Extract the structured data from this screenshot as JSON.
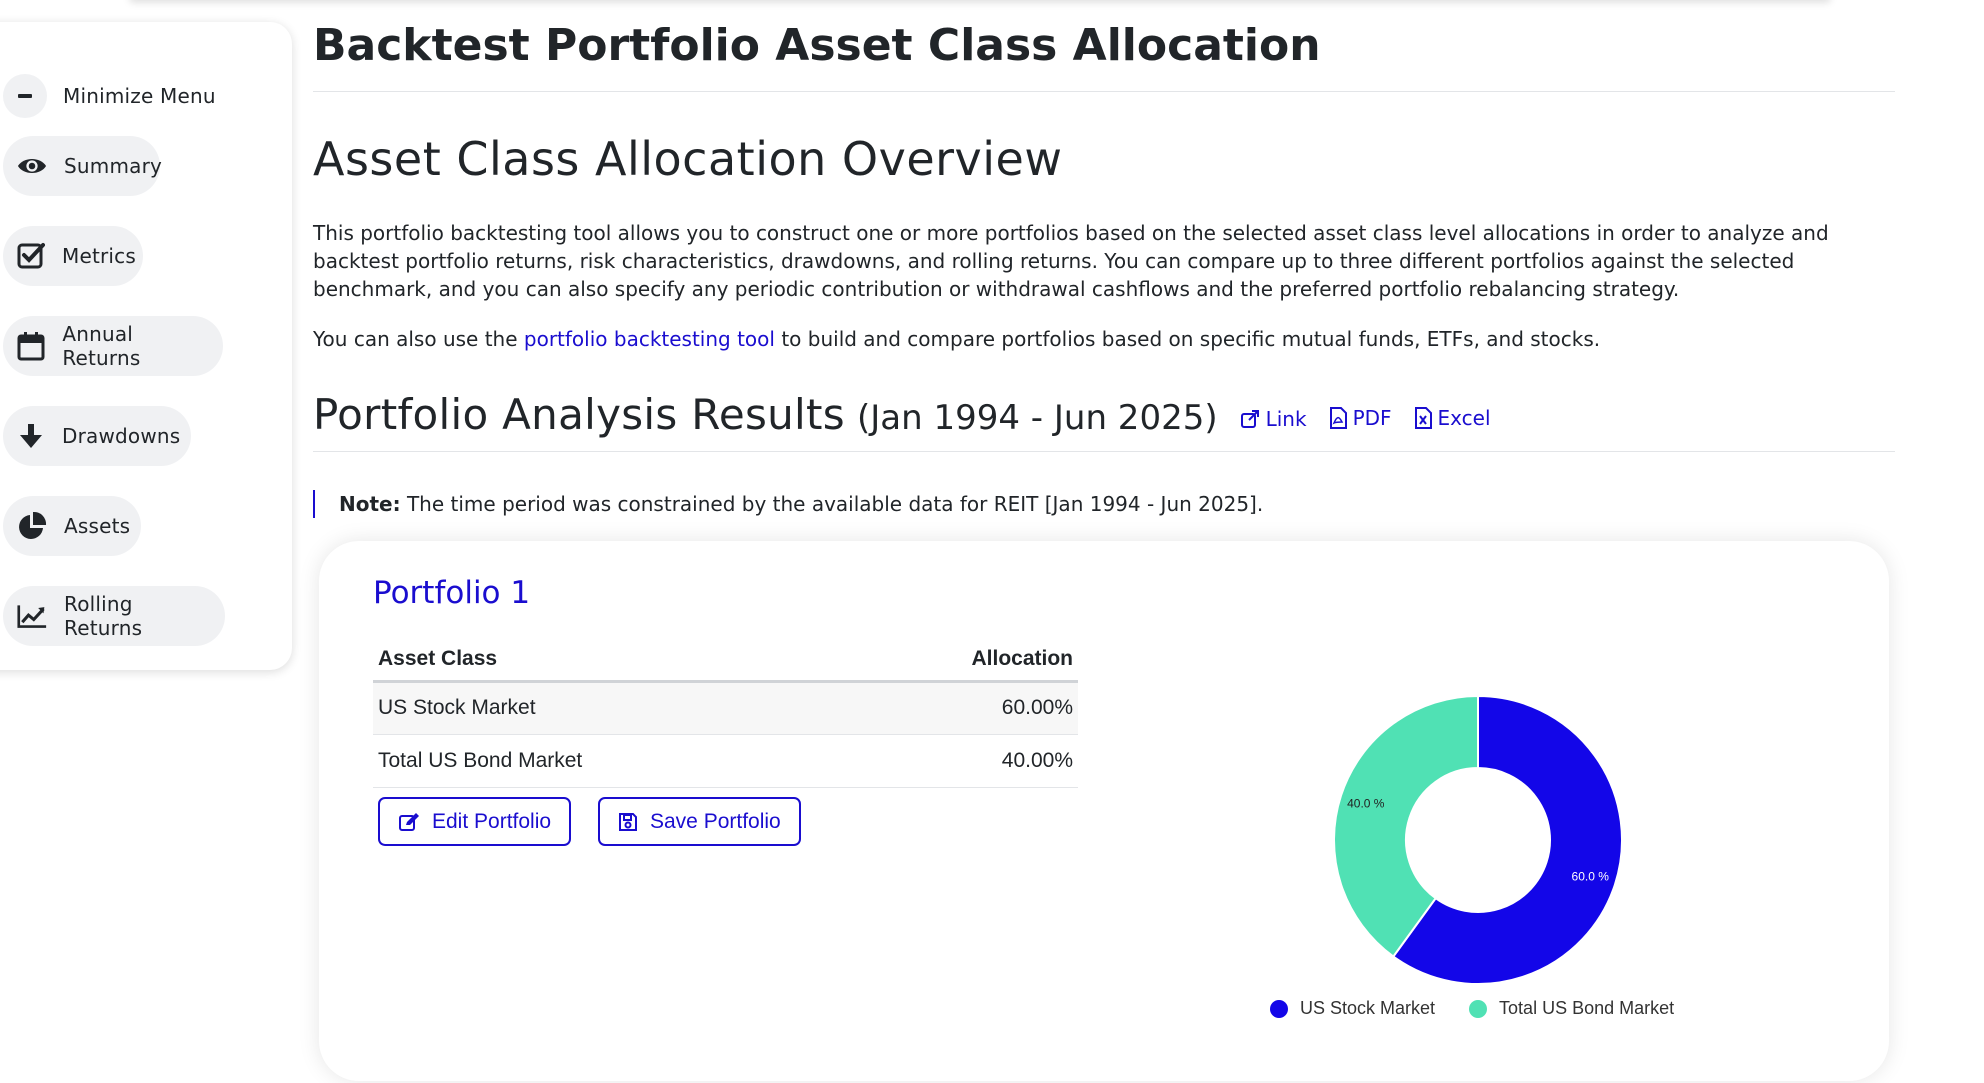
{
  "sidebar": {
    "items": [
      {
        "label": "Minimize Menu",
        "icon": "minus-icon"
      },
      {
        "label": "Summary",
        "icon": "eye-icon"
      },
      {
        "label": "Metrics",
        "icon": "check-square-icon"
      },
      {
        "label": "Annual Returns",
        "icon": "calendar-icon"
      },
      {
        "label": "Drawdowns",
        "icon": "arrow-down-icon"
      },
      {
        "label": "Assets",
        "icon": "pie-chart-icon"
      },
      {
        "label": "Rolling Returns",
        "icon": "line-chart-icon"
      }
    ]
  },
  "page": {
    "title": "Backtest Portfolio Asset Class Allocation",
    "overview_heading": "Asset Class Allocation Overview",
    "overview_text": "This portfolio backtesting tool allows you to construct one or more portfolios based on the selected asset class level allocations in order to analyze and backtest portfolio returns, risk characteristics, drawdowns, and rolling returns. You can compare up to three different portfolios against the selected benchmark, and you can also specify any periodic contribution or withdrawal cashflows and the preferred portfolio rebalancing strategy.",
    "also_prefix": "You can also use the",
    "also_link": "portfolio backtesting tool",
    "also_suffix": "to build and compare portfolios based on specific mutual funds, ETFs, and stocks.",
    "results_heading": "Portfolio Analysis Results",
    "results_period": "(Jan 1994 - Jun 2025)",
    "actions": {
      "link": "Link",
      "pdf": "PDF",
      "excel": "Excel"
    },
    "note_label": "Note:",
    "note_text": "The time period was constrained by the available data for REIT [Jan 1994 - Jun 2025]."
  },
  "portfolio": {
    "title": "Portfolio 1",
    "table_headers": [
      "Asset Class",
      "Allocation"
    ],
    "rows": [
      {
        "asset": "US Stock Market",
        "allocation": "60.00%"
      },
      {
        "asset": "Total US Bond Market",
        "allocation": "40.00%"
      }
    ],
    "edit_label": "Edit Portfolio",
    "save_label": "Save Portfolio"
  },
  "colors": {
    "accent": "#1a0dcf",
    "stock": "#1306e8",
    "bond": "#50e1b4"
  },
  "chart_data": {
    "type": "pie",
    "donut": true,
    "categories": [
      "US Stock Market",
      "Total US Bond Market"
    ],
    "values": [
      60.0,
      40.0
    ],
    "data_labels": [
      "60.0 %",
      "40.0 %"
    ],
    "colors": [
      "#1306e8",
      "#50e1b4"
    ],
    "legend": "bottom"
  }
}
